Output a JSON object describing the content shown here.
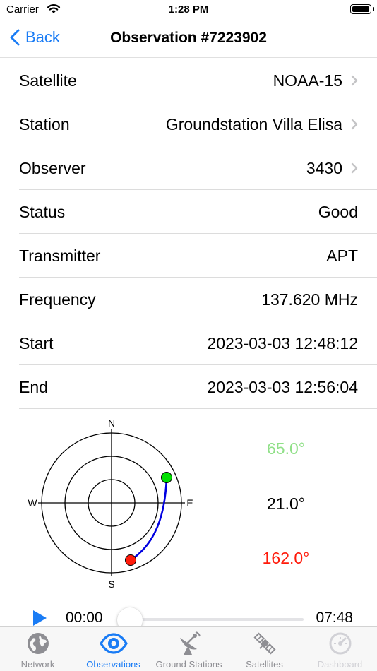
{
  "status_bar": {
    "carrier": "Carrier",
    "time": "1:28 PM"
  },
  "nav": {
    "back_label": "Back",
    "title": "Observation #7223902"
  },
  "rows": [
    {
      "label": "Satellite",
      "value": "NOAA-15"
    },
    {
      "label": "Station",
      "value": "Groundstation Villa Elisa"
    },
    {
      "label": "Observer",
      "value": "3430"
    },
    {
      "label": "Status",
      "value": "Good"
    },
    {
      "label": "Transmitter",
      "value": "APT"
    },
    {
      "label": "Frequency",
      "value": "137.620 MHz"
    },
    {
      "label": "Start",
      "value": "2023-03-03 12:48:12"
    },
    {
      "label": "End",
      "value": "2023-03-03 12:56:04"
    }
  ],
  "polar": {
    "north": "N",
    "south": "S",
    "east": "E",
    "west": "W",
    "max_elevation": "65.0°",
    "elevation_mid": "21.0°",
    "azimuth": "162.0°",
    "colors": {
      "start": "#00e000",
      "end": "#ff1a0a",
      "track": "#0000e0",
      "max": "#90e088",
      "azimuth": "#ff1a0a"
    }
  },
  "player": {
    "current_time": "00:00",
    "total_time": "07:48",
    "progress": 0
  },
  "tabs": [
    {
      "label": "Network",
      "icon": "globe-icon",
      "state": "normal"
    },
    {
      "label": "Observations",
      "icon": "eye-icon",
      "state": "active"
    },
    {
      "label": "Ground Stations",
      "icon": "satellite-dish-icon",
      "state": "normal"
    },
    {
      "label": "Satellites",
      "icon": "satellite-icon",
      "state": "normal"
    },
    {
      "label": "Dashboard",
      "icon": "gauge-icon",
      "state": "disabled"
    }
  ],
  "accent_color": "#1a7cf5"
}
